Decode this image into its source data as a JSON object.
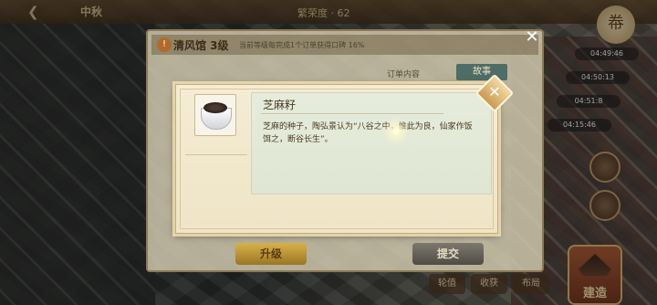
{
  "hud": {
    "season": "中秋",
    "population": "繁荣度 · 62",
    "top_right_icon": "tower-icon"
  },
  "timers": [
    "04:49:46",
    "04:50:13",
    "04:51:8",
    "04:15:46"
  ],
  "bottom_bar": {
    "items": [
      "轮值",
      "收获",
      "布局"
    ],
    "build_label": "建造"
  },
  "order_dialog": {
    "title": "清风馆 3级",
    "description": "当前等级每完成1个订单获得口碑 16%",
    "content_label": "订单内容",
    "tab_label": "故事",
    "upgrade_label": "升级",
    "submit_label": "提交"
  },
  "item_popup": {
    "name": "芝麻籽",
    "description": "芝麻的种子，陶弘景认为“八谷之中，惟此为良，仙家作饭饵之，断谷长生”。",
    "icon": "sesame-bowl-icon"
  },
  "colors": {
    "popup_bg": "#f2e9cf",
    "info_box_bg": "#e3e9d8",
    "accent_gold": "#c99a55"
  }
}
